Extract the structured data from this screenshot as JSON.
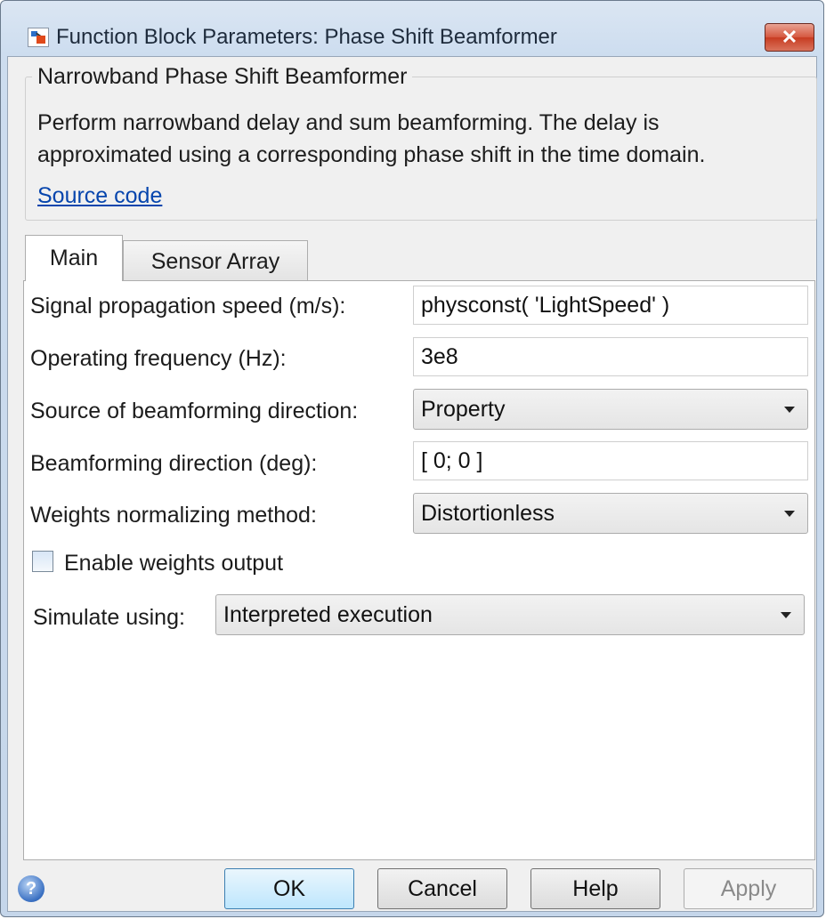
{
  "window": {
    "title": "Function Block Parameters: Phase Shift Beamformer",
    "close_glyph": "✕"
  },
  "group": {
    "title": "Narrowband Phase Shift Beamformer",
    "description_line1": "Perform narrowband delay and sum beamforming. The delay is",
    "description_line2": "approximated using a corresponding phase shift in the time domain.",
    "source_link": "Source code"
  },
  "tabs": [
    {
      "label": "Main",
      "active": true
    },
    {
      "label": "Sensor Array",
      "active": false
    }
  ],
  "params": {
    "propagation_speed": {
      "label": "Signal propagation speed (m/s):",
      "value": "physconst( 'LightSpeed' )"
    },
    "operating_frequency": {
      "label": "Operating frequency (Hz):",
      "value": "3e8"
    },
    "direction_source": {
      "label": "Source of beamforming direction:",
      "value": "Property"
    },
    "direction": {
      "label": "Beamforming direction (deg):",
      "value": "[ 0; 0 ]"
    },
    "normalizing_method": {
      "label": "Weights normalizing method:",
      "value": "Distortionless"
    },
    "weights_output": {
      "label": "Enable weights output",
      "checked": false
    },
    "simulate_using": {
      "label": "Simulate using:",
      "value": "Interpreted execution"
    }
  },
  "buttons": {
    "help_icon": "?",
    "ok": "OK",
    "cancel": "Cancel",
    "help": "Help",
    "apply": "Apply"
  },
  "colors": {
    "link": "#0645ad",
    "close_button": "#c73c21",
    "ok_button": "#bee6fd"
  }
}
